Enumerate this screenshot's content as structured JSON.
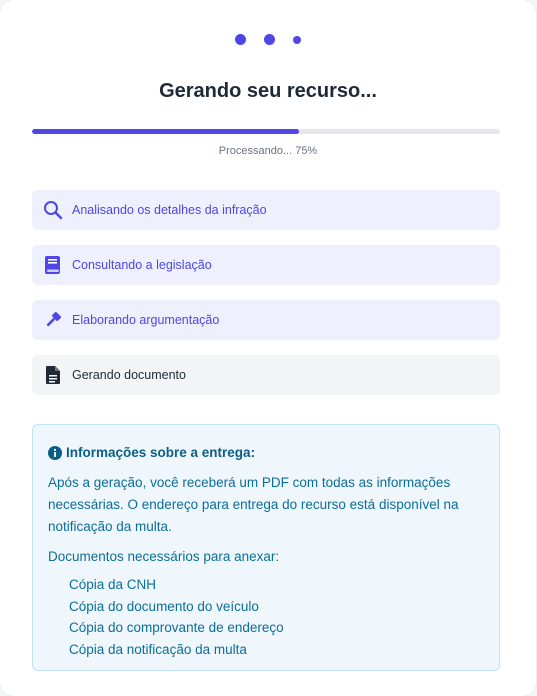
{
  "loading": {
    "title": "Gerando seu recurso..."
  },
  "progress": {
    "percent": 75,
    "label": "Processando... 75%"
  },
  "steps": [
    {
      "label": "Analisando os detalhes da infração",
      "icon": "search-icon",
      "state": "done"
    },
    {
      "label": "Consultando a legislação",
      "icon": "book-icon",
      "state": "done"
    },
    {
      "label": "Elaborando argumentação",
      "icon": "gavel-icon",
      "state": "done"
    },
    {
      "label": "Gerando documento",
      "icon": "document-icon",
      "state": "current"
    }
  ],
  "info": {
    "title": "Informações sobre a entrega:",
    "body": "Após a geração, você receberá um PDF com todas as informações necessárias. O endereço para entrega do recurso está disponível na notificação da multa.",
    "docs_title": "Documentos necessários para anexar:",
    "docs": [
      "Cópia da CNH",
      "Cópia do documento do veículo",
      "Cópia do comprovante de endereço",
      "Cópia da notificação da multa"
    ]
  },
  "colors": {
    "accent": "#4f46e5",
    "step_done_bg": "#eef0fe",
    "step_current_bg": "#f3f4f6",
    "info_bg": "#eff7fc",
    "info_text": "#0b6e99"
  }
}
